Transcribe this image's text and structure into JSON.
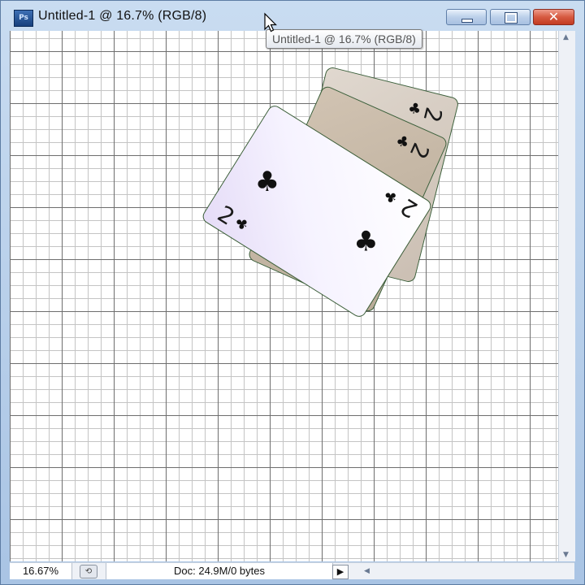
{
  "window": {
    "app_icon": "Ps",
    "title": "Untitled-1 @ 16.7% (RGB/8)",
    "tooltip": "Untitled-1 @ 16.7% (RGB/8)",
    "close_glyph": "✕"
  },
  "canvas": {
    "cards": [
      {
        "rank": "2",
        "suit": "♣",
        "layer": "back"
      },
      {
        "rank": "2",
        "suit": "♣",
        "layer": "middle"
      },
      {
        "rank": "2",
        "suit": "♣",
        "layer": "front"
      }
    ]
  },
  "status": {
    "zoom": "16.67%",
    "doc_info": "Doc: 24.9M/0 bytes",
    "menu_arrow": "▶"
  },
  "scroll": {
    "up": "▲",
    "down": "▼",
    "left": "◀"
  },
  "colors": {
    "frame": "#b9d3ee",
    "close_button": "#d65a41",
    "grid_major": "#6e6e6e",
    "grid_minor": "#c4c4c4"
  }
}
